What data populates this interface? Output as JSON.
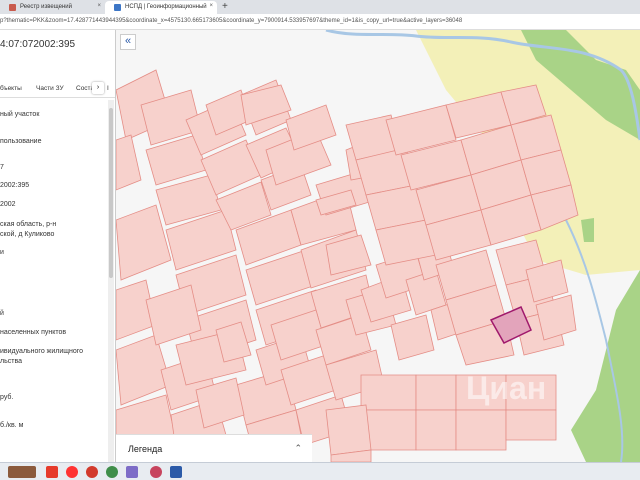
{
  "browser": {
    "tabs": [
      {
        "label": "Реестр извещений"
      },
      {
        "label": "НСПД | Геоинформационный"
      }
    ],
    "new_tab": "+",
    "close": "×",
    "url": "p?thematic=PKK&zoom=17.428771443944395&coordinate_x=4575130.665173605&coordinate_y=7900914.533957697&theme_id=1&is_copy_url=true&active_layers=36048"
  },
  "panel": {
    "cadastral_number": "4:07:072002:395",
    "tabs": [
      "бъекты",
      "Части ЗУ",
      "Состав"
    ],
    "more": "›",
    "tab_cut": "I",
    "lines": [
      "ный участок",
      "пользование",
      "7",
      "2002:395",
      "2002",
      "ская область, р-н",
      "ской, д Куликово",
      "и",
      "й",
      "населенных пунктов",
      "ивидуального жилищного",
      "льства",
      "руб.",
      "б./кв. м"
    ]
  },
  "map": {
    "collapse": "«",
    "legend": "Легенда",
    "legend_arrow": "⌃",
    "watermark": "Циан",
    "colors": {
      "parcel_fill": "#f7d1cc",
      "parcel_stroke": "#e48d86",
      "selected_fill": "#e3a4bb",
      "selected_stroke": "#a0196c",
      "green": "#a9d387",
      "yellow": "#f3f0b8",
      "river": "#a8c7e5",
      "road": "#ffffff"
    }
  },
  "taskbar": {
    "icons": [
      "start-icon",
      "yandex-icon",
      "opera-icon",
      "yandex-browser-icon",
      "chrome-icon",
      "photos-icon",
      "ccleaner-icon",
      "word-icon"
    ]
  }
}
